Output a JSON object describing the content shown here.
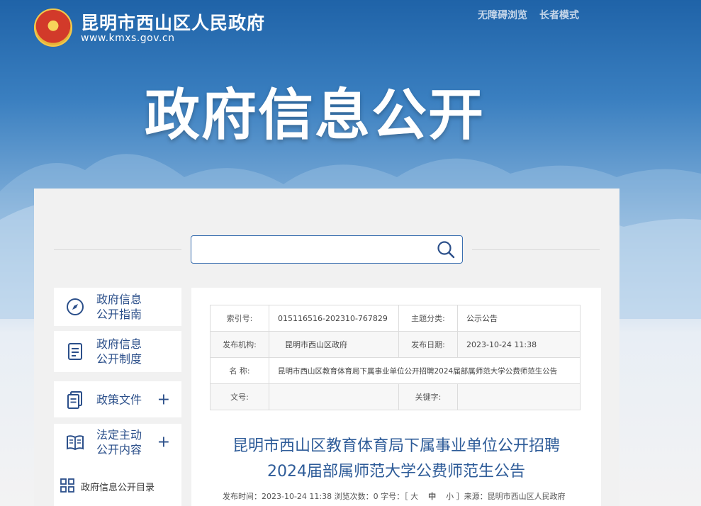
{
  "header": {
    "site_name": "昆明市西山区人民政府",
    "site_url": "www.kmxs.gov.cn",
    "links": [
      "无障碍浏览",
      "长者模式"
    ],
    "banner_title": "政府信息公开"
  },
  "search": {
    "value": "",
    "placeholder": ""
  },
  "sidebar": {
    "items": [
      {
        "label_line1": "政府信息",
        "label_line2": "公开指南",
        "icon": "compass-icon"
      },
      {
        "label_line1": "政府信息",
        "label_line2": "公开制度",
        "icon": "document-icon"
      },
      {
        "label_line1": "政策文件",
        "label_line2": "",
        "icon": "files-icon",
        "expand": "+"
      },
      {
        "label_line1": "法定主动",
        "label_line2": "公开内容",
        "icon": "book-icon",
        "expand": "+"
      }
    ],
    "catalog": {
      "label": "政府信息公开目录",
      "icon": "grid-icon"
    }
  },
  "meta": {
    "index_no_label": "索引号:",
    "index_no": "015116516-202310-767829",
    "category_label": "主题分类:",
    "category": "公示公告",
    "publisher_label": "发布机构:",
    "publisher": "昆明市西山区政府",
    "date_label": "发布日期:",
    "date": "2023-10-24 11:38",
    "name_label": "名  称:",
    "name": "昆明市西山区教育体育局下属事业单位公开招聘2024届部属师范大学公费师范生公告",
    "doc_no_label": "文号:",
    "doc_no": "",
    "keywords_label": "关键字:",
    "keywords": ""
  },
  "article": {
    "title_line1": "昆明市西山区教育体育局下属事业单位公开招聘",
    "title_line2": "2024届部属师范大学公费师范生公告",
    "info_prefix": "发布时间：2023-10-24 11:38 浏览次数：0 字号：［",
    "size_large": "大",
    "size_medium": "中",
    "size_small": "小",
    "info_suffix": "］来源：昆明市西山区人民政府"
  },
  "colors": {
    "primary": "#2b4f8a",
    "banner": "#1f63a8",
    "title": "#2d5b98"
  }
}
